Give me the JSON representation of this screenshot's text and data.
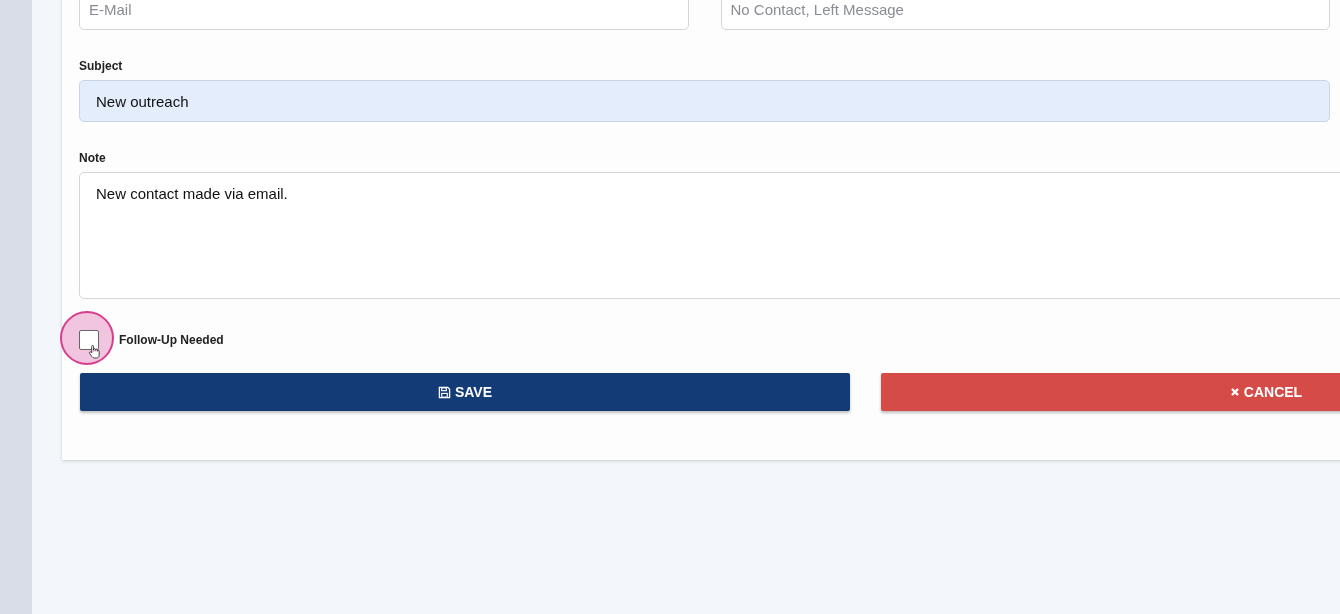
{
  "top_fields": [
    {
      "placeholder": "E-Mail"
    },
    {
      "placeholder": "No Contact, Left Message"
    }
  ],
  "subject": {
    "label": "Subject",
    "value": "New outreach"
  },
  "note": {
    "label": "Note",
    "value": "New contact made via email."
  },
  "follow_up": {
    "label": "Follow-Up Needed",
    "checked": false
  },
  "buttons": [
    {
      "kind": "save",
      "label": "SAVE"
    },
    {
      "kind": "cancel",
      "label": "CANCEL"
    }
  ]
}
